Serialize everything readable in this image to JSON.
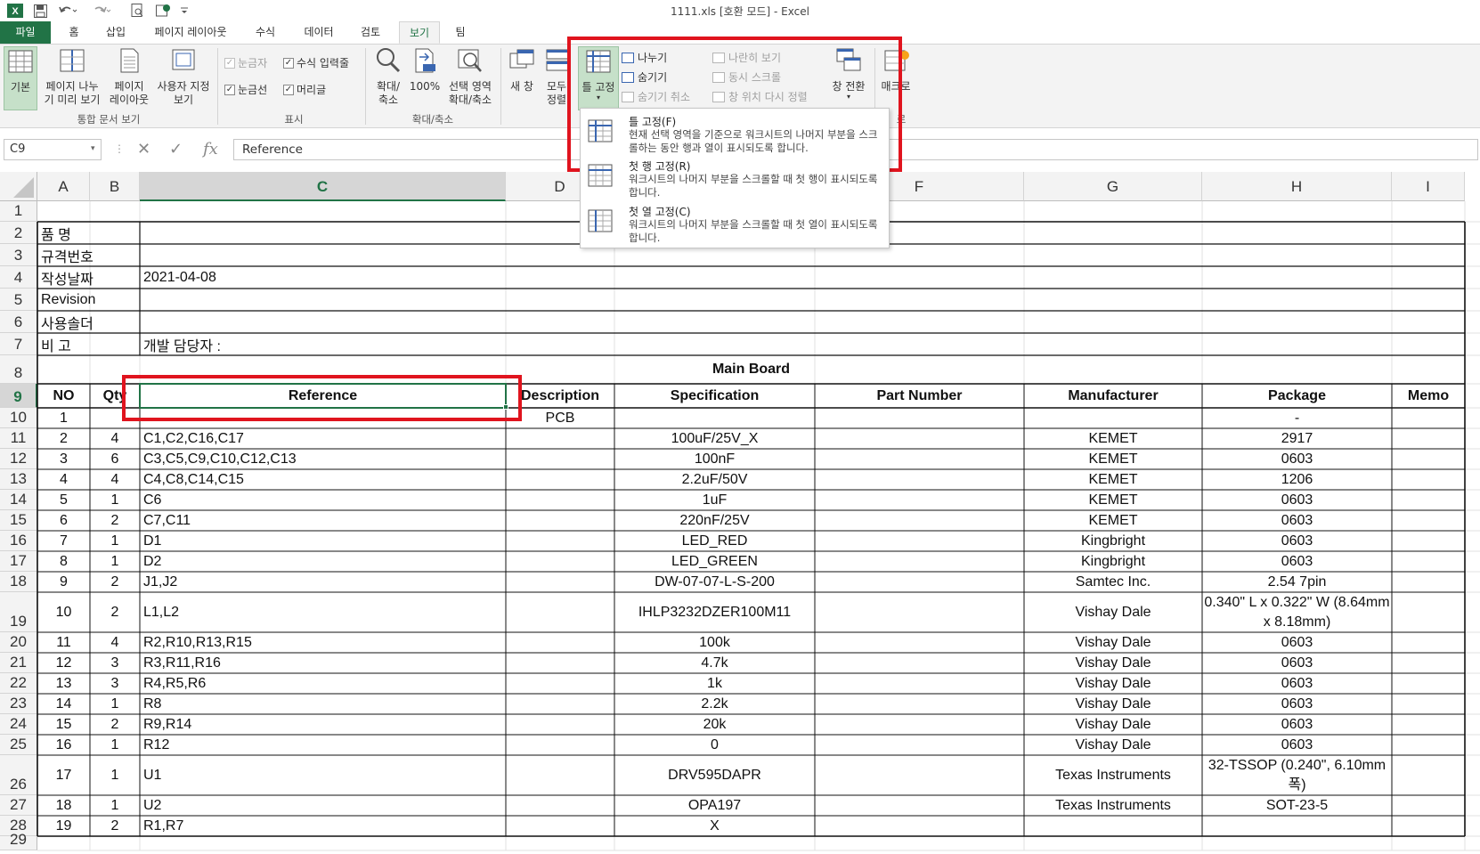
{
  "titlebar": {
    "title": "1111.xls  [호환 모드] - Excel",
    "app_icon": "excel-logo",
    "quick_access": [
      "save-icon",
      "undo-icon",
      "redo-icon",
      "print-preview-icon",
      "macro-icon",
      "customize-dropdown-icon"
    ]
  },
  "tabs": [
    {
      "label": "파일"
    },
    {
      "label": "홈"
    },
    {
      "label": "삽입"
    },
    {
      "label": "페이지 레이아웃"
    },
    {
      "label": "수식"
    },
    {
      "label": "데이터"
    },
    {
      "label": "검토"
    },
    {
      "label": "보기"
    },
    {
      "label": "팀"
    }
  ],
  "ribbon": {
    "workbook_views": {
      "normal": "기본",
      "page_break_1": "페이지 나누",
      "page_break_2": "기 미리 보기",
      "page_layout_1": "페이지",
      "page_layout_2": "레이아웃",
      "custom_1": "사용자 지정",
      "custom_2": "보기",
      "group": "통합 문서 보기"
    },
    "show": {
      "ruler": "눈금자",
      "formula_bar": "수식 입력줄",
      "gridlines": "눈금선",
      "headings": "머리글",
      "group": "표시"
    },
    "zoom": {
      "zoom_1": "확대/",
      "zoom_2": "축소",
      "hundred": "100%",
      "selection_1": "선택 영역",
      "selection_2": "확대/축소",
      "group": "확대/축소"
    },
    "window": {
      "new_window": "새 창",
      "arrange_all_1": "모두",
      "arrange_all_2": "정렬",
      "freeze": "틀 고정",
      "split": "나누기",
      "hide": "숨기기",
      "unhide": "숨기기 취소",
      "side_by_side": "나란히 보기",
      "sync_scroll": "동시 스크롤",
      "reset_position": "창 위치 다시 정렬",
      "switch": "창 전환",
      "macro": "매크로",
      "group_tail": "로"
    }
  },
  "freeze_menu": [
    {
      "title": "틀 고정(F)",
      "desc": "현재 선택 영역을 기준으로 워크시트의 나머지 부분을 스크롤하는 동안 행과 열이 표시되도록 합니다."
    },
    {
      "title": "첫 행 고정(R)",
      "desc": "워크시트의 나머지 부분을 스크롤할 때 첫 행이 표시되도록 합니다."
    },
    {
      "title": "첫 열 고정(C)",
      "desc": "워크시트의 나머지 부분을 스크롤할 때 첫 열이 표시되도록 합니다."
    }
  ],
  "formula_bar": {
    "name_box": "C9",
    "content": "Reference",
    "fx": "fx"
  },
  "sheet": {
    "columns": [
      "A",
      "B",
      "C",
      "D",
      "E",
      "F",
      "G",
      "H",
      "I"
    ],
    "rows": [
      "1",
      "2",
      "3",
      "4",
      "5",
      "6",
      "7",
      "8",
      "9",
      "10",
      "11",
      "12",
      "13",
      "14",
      "15",
      "16",
      "17",
      "18",
      "19",
      "20",
      "21",
      "22",
      "23",
      "24",
      "25",
      "26",
      "27",
      "28",
      "29"
    ],
    "info": [
      {
        "label": "품    명",
        "value": ""
      },
      {
        "label": "규격번호",
        "value": ""
      },
      {
        "label": "작성날짜",
        "value": "2021-04-08"
      },
      {
        "label": "Revision",
        "value": ""
      },
      {
        "label": "사용솔더",
        "value": ""
      },
      {
        "label": "비    고",
        "value": "개발 담당자 :"
      }
    ],
    "board_title": "Main Board",
    "headers": [
      "NO",
      "Qty",
      "Reference",
      "Description",
      "Specification",
      "Part Number",
      "Manufacturer",
      "Package",
      "Memo"
    ],
    "items": [
      [
        "1",
        "",
        "",
        "PCB",
        "",
        "",
        "",
        "-",
        ""
      ],
      [
        "2",
        "4",
        "C1,C2,C16,C17",
        "",
        "100uF/25V_X",
        "",
        "KEMET",
        "2917",
        ""
      ],
      [
        "3",
        "6",
        "C3,C5,C9,C10,C12,C13",
        "",
        "100nF",
        "",
        "KEMET",
        "0603",
        ""
      ],
      [
        "4",
        "4",
        "C4,C8,C14,C15",
        "",
        "2.2uF/50V",
        "",
        "KEMET",
        "1206",
        ""
      ],
      [
        "5",
        "1",
        "C6",
        "",
        "1uF",
        "",
        "KEMET",
        "0603",
        ""
      ],
      [
        "6",
        "2",
        "C7,C11",
        "",
        "220nF/25V",
        "",
        "KEMET",
        "0603",
        ""
      ],
      [
        "7",
        "1",
        "D1",
        "",
        "LED_RED",
        "",
        "Kingbright",
        "0603",
        ""
      ],
      [
        "8",
        "1",
        "D2",
        "",
        "LED_GREEN",
        "",
        "Kingbright",
        "0603",
        ""
      ],
      [
        "9",
        "2",
        "J1,J2",
        "",
        "DW-07-07-L-S-200",
        "",
        "Samtec Inc.",
        "2.54 7pin",
        ""
      ],
      [
        "10",
        "2",
        "L1,L2",
        "",
        "IHLP3232DZER100M11",
        "",
        "Vishay Dale",
        "0.340\" L x 0.322\" W (8.64mm x 8.18mm)",
        ""
      ],
      [
        "11",
        "4",
        "R2,R10,R13,R15",
        "",
        "100k",
        "",
        "Vishay Dale",
        "0603",
        ""
      ],
      [
        "12",
        "3",
        "R3,R11,R16",
        "",
        "4.7k",
        "",
        "Vishay Dale",
        "0603",
        ""
      ],
      [
        "13",
        "3",
        "R4,R5,R6",
        "",
        "1k",
        "",
        "Vishay Dale",
        "0603",
        ""
      ],
      [
        "14",
        "1",
        "R8",
        "",
        "2.2k",
        "",
        "Vishay Dale",
        "0603",
        ""
      ],
      [
        "15",
        "2",
        "R9,R14",
        "",
        "20k",
        "",
        "Vishay Dale",
        "0603",
        ""
      ],
      [
        "16",
        "1",
        "R12",
        "",
        "0",
        "",
        "Vishay Dale",
        "0603",
        ""
      ],
      [
        "17",
        "1",
        "U1",
        "",
        "DRV595DAPR",
        "",
        "Texas Instruments",
        "32-TSSOP (0.240\", 6.10mm 폭)",
        ""
      ],
      [
        "18",
        "1",
        "U2",
        "",
        "OPA197",
        "",
        "Texas Instruments",
        "SOT-23-5",
        ""
      ],
      [
        "19",
        "2",
        "R1,R7",
        "",
        "X",
        "",
        "",
        "",
        ""
      ]
    ]
  },
  "colors": {
    "excel_green": "#217346",
    "highlight_red": "#e0141e",
    "ribbon_bg": "#f3f3f3"
  }
}
